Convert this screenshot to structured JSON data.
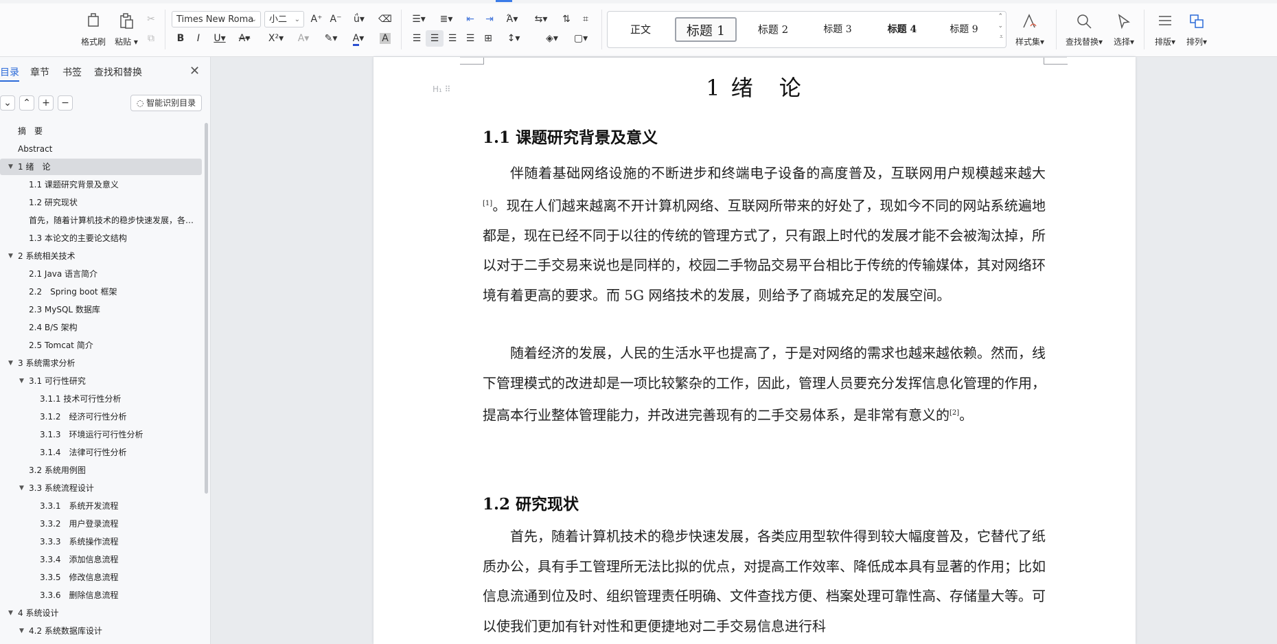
{
  "toolbar": {
    "format_painter": "格式刷",
    "paste": "粘贴",
    "font_name": "Times New Roma",
    "font_size": "小二",
    "styles": [
      "正文",
      "标题 1",
      "标题 2",
      "标题 3",
      "标题 4",
      "标题 9"
    ],
    "style_set": "样式集",
    "find_replace": "查找替换",
    "select": "选择",
    "layout": "排版",
    "arrange": "排列"
  },
  "panel": {
    "tabs": [
      "目录",
      "章节",
      "书签",
      "查找和替换"
    ],
    "smart_toc": "智能识别目录",
    "toc": [
      {
        "text": "摘　要",
        "level": 1
      },
      {
        "text": "Abstract",
        "level": 1
      },
      {
        "text": "1 绪　论",
        "level": 1,
        "expanded": true,
        "current": true
      },
      {
        "text": "1.1 课题研究背景及意义",
        "level": 2
      },
      {
        "text": "1.2 研究现状",
        "level": 2
      },
      {
        "text": "首先，随着计算机技术的稳步快速发展，各类应用型软件得到较大幅度普及",
        "level": 2
      },
      {
        "text": "1.3 本论文的主要论文结构",
        "level": 2
      },
      {
        "text": "2 系统相关技术",
        "level": 1,
        "expanded": true
      },
      {
        "text": "2.1 Java 语言简介",
        "level": 2
      },
      {
        "text": "2.2　Spring boot 框架",
        "level": 2
      },
      {
        "text": "2.3 MySQL 数据库",
        "level": 2
      },
      {
        "text": "2.4 B/S 架构",
        "level": 2
      },
      {
        "text": "2.5 Tomcat 简介",
        "level": 2
      },
      {
        "text": "3 系统需求分析",
        "level": 1,
        "expanded": true
      },
      {
        "text": "3.1 可行性研究",
        "level": 2,
        "expanded": true
      },
      {
        "text": "3.1.1 技术可行性分析",
        "level": 3
      },
      {
        "text": "3.1.2　经济可行性分析",
        "level": 3
      },
      {
        "text": "3.1.3　环境运行可行性分析",
        "level": 3
      },
      {
        "text": "3.1.4　法律可行性分析",
        "level": 3
      },
      {
        "text": "3.2 系统用例图",
        "level": 2
      },
      {
        "text": "3.3 系统流程设计",
        "level": 2,
        "expanded": true
      },
      {
        "text": "3.3.1　系统开发流程",
        "level": 3
      },
      {
        "text": "3.3.2　用户登录流程",
        "level": 3
      },
      {
        "text": "3.3.3　系统操作流程",
        "level": 3
      },
      {
        "text": "3.3.4　添加信息流程",
        "level": 3
      },
      {
        "text": "3.3.5　修改信息流程",
        "level": 3
      },
      {
        "text": "3.3.6　删除信息流程",
        "level": 3
      },
      {
        "text": "4 系统设计",
        "level": 1,
        "expanded": true
      },
      {
        "text": "4.2 系统数据库设计",
        "level": 2,
        "expanded": true
      }
    ]
  },
  "document": {
    "chapter_title": "1 绪　论",
    "heading_marker": "H₁ ⠿",
    "section1_title": "1.1 课题研究背景及意义",
    "p1_a": "伴随着基础网络设施的不断进步和终端电子设备的高度普及，互联网用户规模越来越大",
    "ref1": "[1]",
    "p1_b": "。现在人们越来越离不开计算机网络、互联网所带来的好处了，现如今不同的网站系统遍地都是，现在已经不同于以往的传统的管理方式了，只有跟上时代的发展才能不会被淘汰掉，所以对于二手交易来说也是同样的，校园二手物品交易平台相比于传统的传输媒体，其对网络环境有着更高的要求。而 5G 网络技术的发展，则给予了商城充足的发展空间。",
    "p2_a": "随着经济的发展，人民的生活水平也提高了，于是对网络的需求也越来越依赖。然而，线下管理模式的改进却是一项比较繁杂的工作，因此，管理人员要充分发挥信息化管理的作用，提高本行业整体管理能力，并改进完善现有的二手交易体系，是非常有意义的",
    "ref2": "[2]",
    "p2_b": "。",
    "section2_title": "1.2 研究现状",
    "p3": "首先，随着计算机技术的稳步快速发展，各类应用型软件得到较大幅度普及，它替代了纸质办公，具有手工管理所无法比拟的优点，对提高工作效率、降低成本具有显著的作用；比如信息流通到位及时、组织管理责任明确、文件查找方便、档案处理可靠性高、存储量大等。可以使我们更加有针对性和更便捷地对二手交易信息进行科"
  }
}
